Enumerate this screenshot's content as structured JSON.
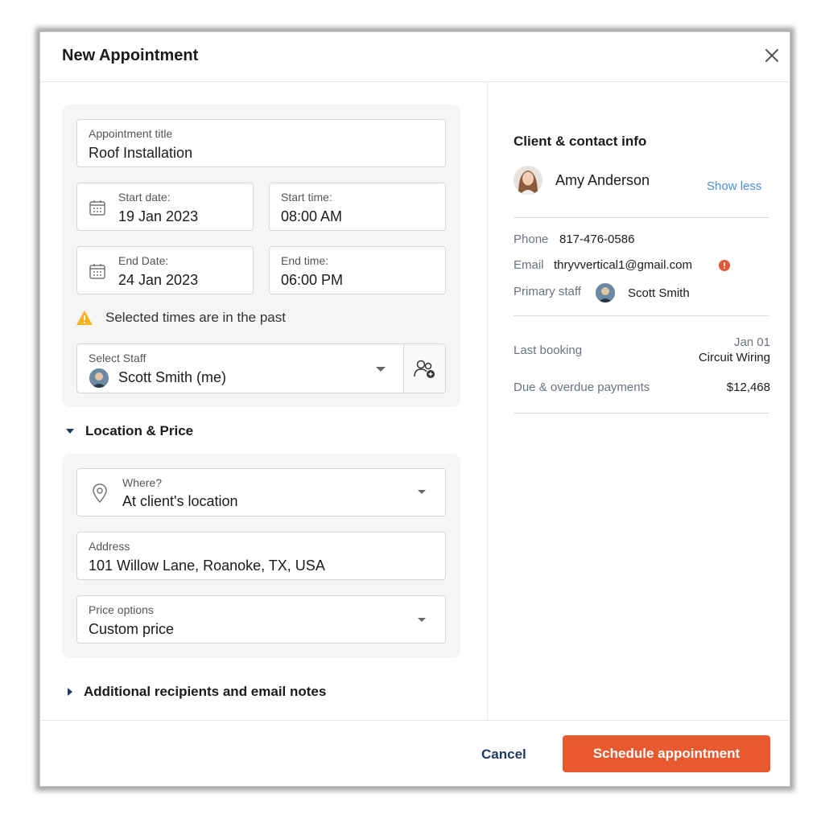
{
  "modal": {
    "title": "New Appointment"
  },
  "form": {
    "appointment_title": {
      "label": "Appointment title",
      "value": "Roof Installation"
    },
    "start_date": {
      "label": "Start date:",
      "value": "19 Jan 2023"
    },
    "start_time": {
      "label": "Start time:",
      "value": "08:00 AM"
    },
    "end_date": {
      "label": "End Date:",
      "value": "24 Jan 2023"
    },
    "end_time": {
      "label": "End time:",
      "value": "06:00 PM"
    },
    "warning": "Selected times are in the past",
    "staff": {
      "label": "Select Staff",
      "value": "Scott Smith (me)"
    }
  },
  "location_section": {
    "title": "Location & Price",
    "where": {
      "label": "Where?",
      "value": "At client's location"
    },
    "address": {
      "label": "Address",
      "value": "101 Willow Lane, Roanoke, TX, USA"
    },
    "price": {
      "label": "Price options",
      "value": "Custom price"
    }
  },
  "additional_section": {
    "title": "Additional recipients and email notes"
  },
  "client": {
    "section_title": "Client & contact info",
    "name": "Amy Anderson",
    "toggle_label": "Show less",
    "phone_label": "Phone",
    "phone": "817-476-0586",
    "email_label": "Email",
    "email": "thryvvertical1@gmail.com",
    "staff_label": "Primary staff",
    "staff": "Scott Smith",
    "last_booking_label": "Last booking",
    "last_booking_date": "Jan 01",
    "last_booking_service": "Circuit Wiring",
    "due_label": "Due & overdue payments",
    "due_amount": "$12,468"
  },
  "footer": {
    "cancel_label": "Cancel",
    "submit_label": "Schedule appointment"
  },
  "colors": {
    "accent": "#e9592f",
    "link": "#4a90d9",
    "warning": "#f5b324",
    "error": "#e0573a"
  }
}
